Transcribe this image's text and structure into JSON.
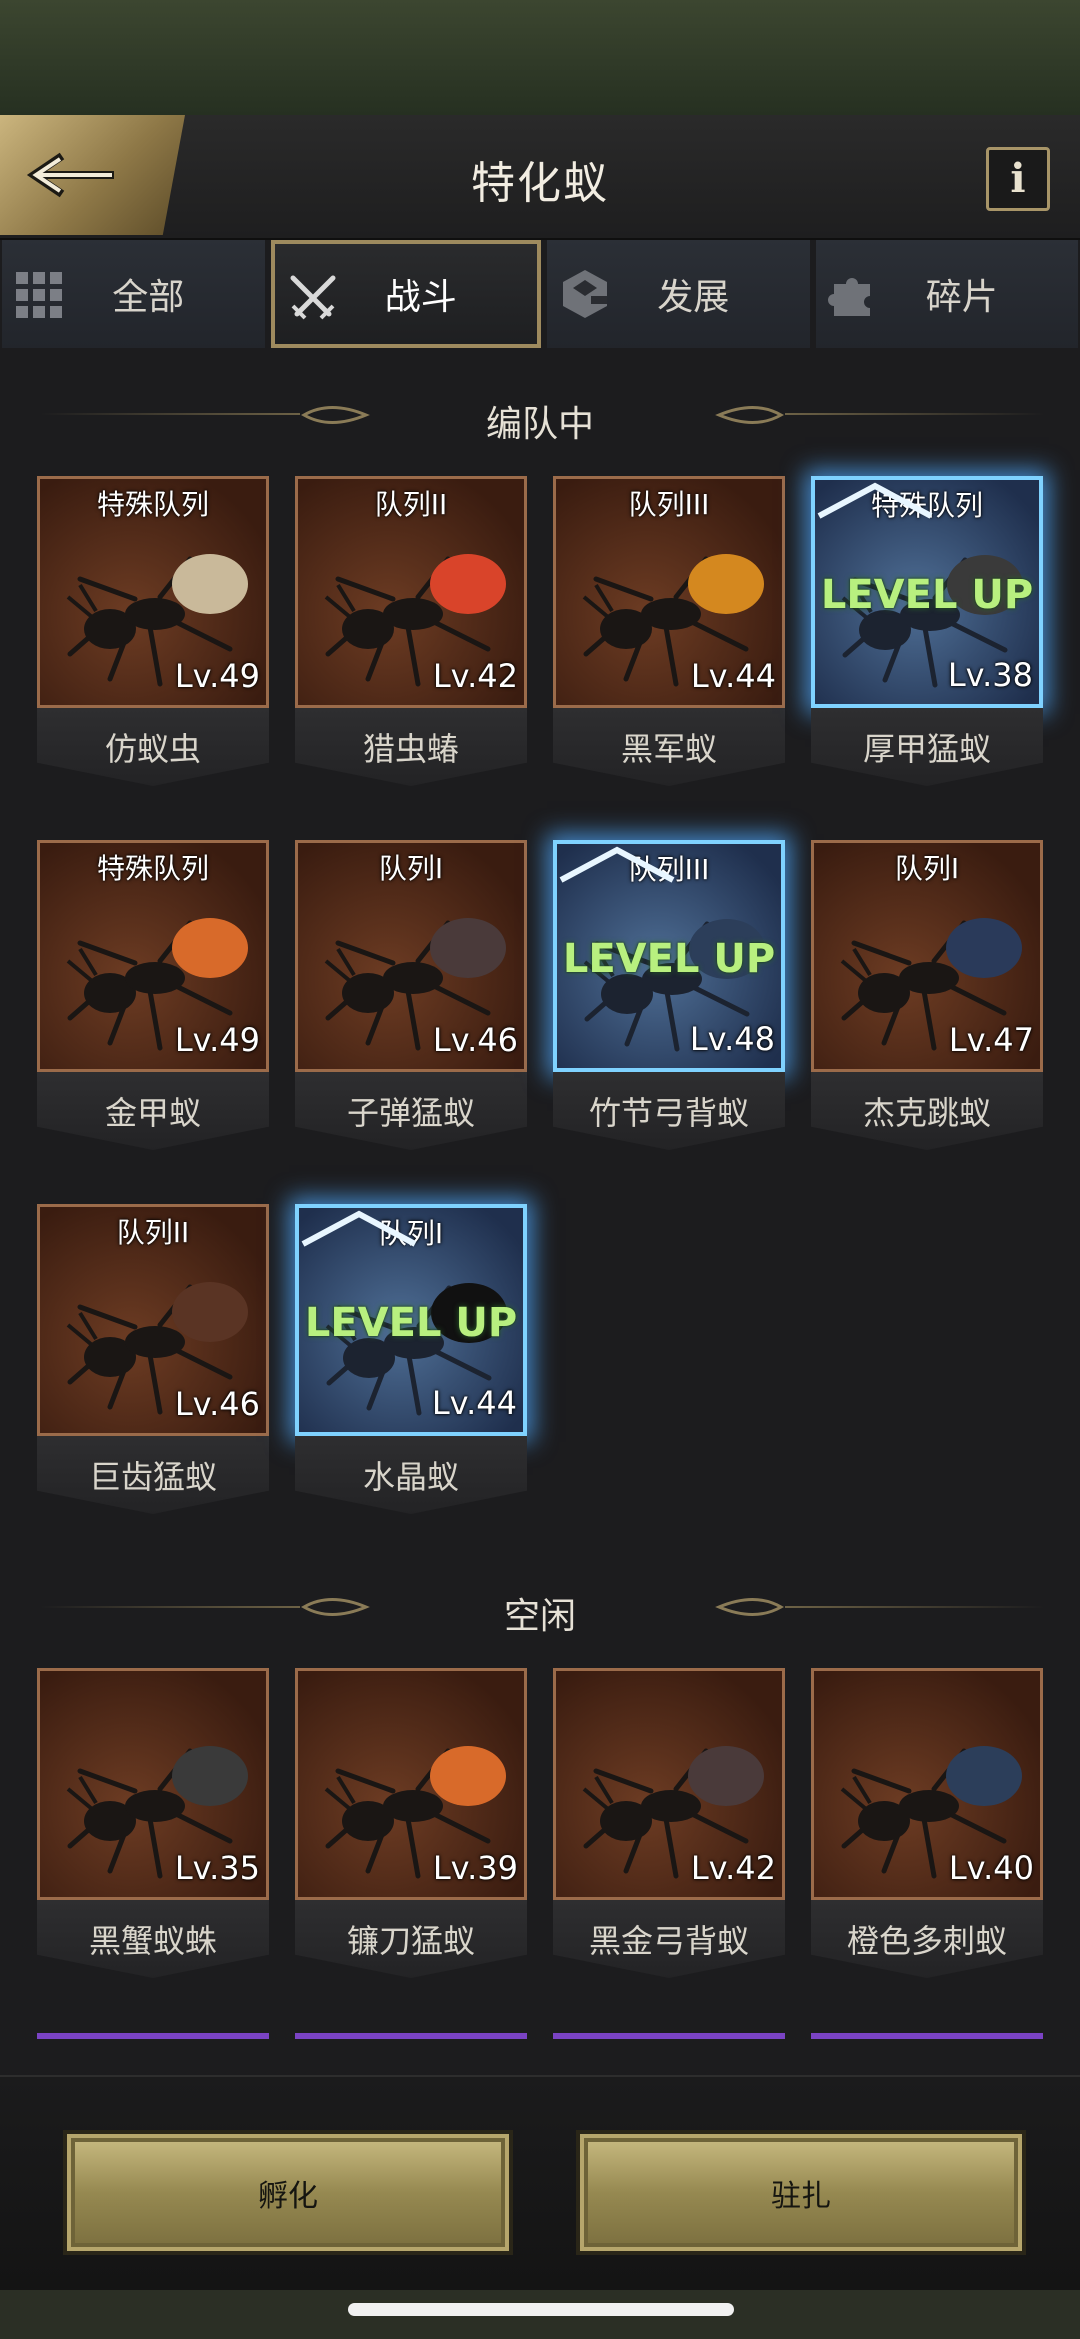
{
  "header": {
    "title": "特化蚁",
    "back_icon": "back-arrow-icon",
    "info_label": "i"
  },
  "tabs": [
    {
      "label": "全部",
      "icon": "grid-icon",
      "active": false
    },
    {
      "label": "战斗",
      "icon": "crossed-swords-icon",
      "active": true
    },
    {
      "label": "发展",
      "icon": "build-icon",
      "active": false
    },
    {
      "label": "碎片",
      "icon": "puzzle-icon",
      "active": false
    }
  ],
  "sections": {
    "in_team": {
      "title": "编队中"
    },
    "idle": {
      "title": "空闲"
    }
  },
  "in_team_cards": [
    {
      "name": "仿蚁虫",
      "squad": "特殊队列",
      "level": "Lv.49",
      "level_up": false
    },
    {
      "name": "猎虫蝽",
      "squad": "队列II",
      "level": "Lv.42",
      "level_up": false
    },
    {
      "name": "黑军蚁",
      "squad": "队列III",
      "level": "Lv.44",
      "level_up": false
    },
    {
      "name": "厚甲猛蚁",
      "squad": "特殊队列",
      "level": "Lv.38",
      "level_up": true
    },
    {
      "name": "金甲蚁",
      "squad": "特殊队列",
      "level": "Lv.49",
      "level_up": false
    },
    {
      "name": "子弹猛蚁",
      "squad": "队列I",
      "level": "Lv.46",
      "level_up": false
    },
    {
      "name": "竹节弓背蚁",
      "squad": "队列III",
      "level": "Lv.48",
      "level_up": true
    },
    {
      "name": "杰克跳蚁",
      "squad": "队列I",
      "level": "Lv.47",
      "level_up": false
    },
    {
      "name": "巨齿猛蚁",
      "squad": "队列II",
      "level": "Lv.46",
      "level_up": false
    },
    {
      "name": "水晶蚁",
      "squad": "队列I",
      "level": "Lv.44",
      "level_up": true
    }
  ],
  "idle_cards": [
    {
      "name": "黑蟹蚁蛛",
      "level": "Lv.35"
    },
    {
      "name": "镰刀猛蚁",
      "level": "Lv.39"
    },
    {
      "name": "黑金弓背蚁",
      "level": "Lv.42"
    },
    {
      "name": "橙色多刺蚁",
      "level": "Lv.40"
    }
  ],
  "level_up_text": "LEVEL UP",
  "actions": {
    "hatch_label": "孵化",
    "station_label": "驻扎"
  },
  "colors": {
    "gold": "#9e8a5e",
    "glow": "#7fd2ff",
    "levelup": "#b8f07f",
    "card_bg": "#6d3c23"
  }
}
